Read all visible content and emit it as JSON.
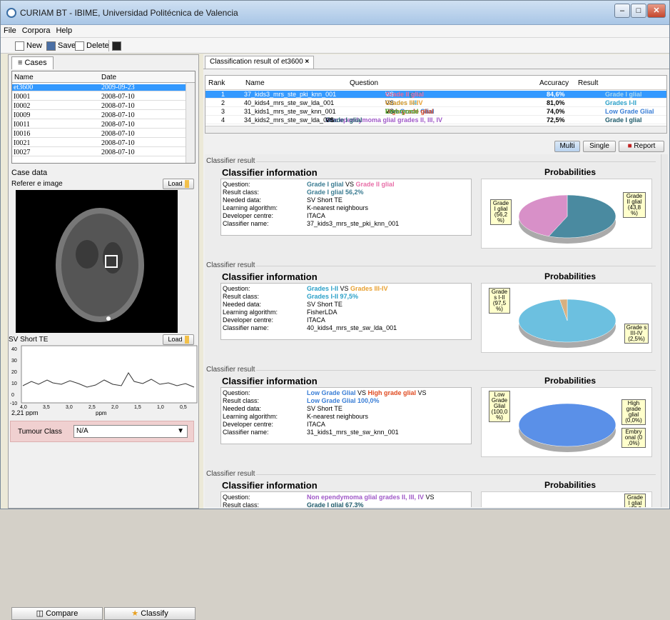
{
  "window": {
    "title": "CURIAM BT - IBIME, Universidad Politécnica de Valencia"
  },
  "menu": [
    "File",
    "Corpora",
    "Help"
  ],
  "toolbar": {
    "new": "New",
    "save": "Save",
    "delete": "Delete"
  },
  "cases": {
    "tab": "Cases",
    "col_name": "Name",
    "col_date": "Date",
    "rows": [
      {
        "name": "et3600",
        "date": "2009-09-23"
      },
      {
        "name": "I0001",
        "date": "2008-07-10"
      },
      {
        "name": "I0002",
        "date": "2008-07-10"
      },
      {
        "name": "I0009",
        "date": "2008-07-10"
      },
      {
        "name": "I0011",
        "date": "2008-07-10"
      },
      {
        "name": "I0016",
        "date": "2008-07-10"
      },
      {
        "name": "I0021",
        "date": "2008-07-10"
      },
      {
        "name": "I0027",
        "date": "2008-07-10"
      }
    ]
  },
  "case_data": {
    "title": "Case data",
    "ref_image": "Referer  e image",
    "load": "Load",
    "sv_label": "SV Short TE",
    "spectrum": {
      "y_ticks": [
        "40",
        "30",
        "20",
        "10",
        "0",
        "-10"
      ],
      "x_ticks": [
        "4,0",
        "3,5",
        "3,0",
        "2,5",
        "2,0",
        "1,5",
        "1,0",
        "0,5"
      ],
      "x_unit": "ppm",
      "cursor": "2,21 ppm"
    },
    "tumour_label": "Tumour Class",
    "tumour_value": "N/A"
  },
  "bottom": {
    "compare": "Compare",
    "classify": "Classify"
  },
  "right": {
    "tab": "Classification result of et3600",
    "tab_close": "×",
    "cols": {
      "rank": "Rank",
      "name": "Name",
      "question": "Question",
      "accuracy": "Accuracy",
      "result": "Result"
    },
    "rows": [
      {
        "rank": "1",
        "name": "37_kids3_mrs_ste_pki_knn_001",
        "accuracy": "84,6%",
        "result": "Grade I glial",
        "q": [
          [
            "Grade I glial",
            "hl-teal"
          ],
          [
            " VS ",
            ""
          ],
          [
            "Grade II glial",
            "hl-pink"
          ]
        ]
      },
      {
        "rank": "2",
        "name": "40_kids4_mrs_ste_sw_lda_001",
        "accuracy": "81,0%",
        "result": "Grades I-II",
        "q": [
          [
            "Grades I-II",
            "hl-cyan"
          ],
          [
            " VS ",
            ""
          ],
          [
            "Grades III-IV",
            "hl-orange"
          ]
        ]
      },
      {
        "rank": "3",
        "name": "31_kids1_mrs_ste_sw_knn_001",
        "accuracy": "74,0%",
        "result": "Low Grade Glial",
        "q": [
          [
            "Low Grade Glial",
            "hl-blue"
          ],
          [
            " VS ",
            ""
          ],
          [
            "High grade glial",
            "hl-red"
          ],
          [
            " VS ",
            ""
          ],
          [
            "Embryonal",
            "hl-green"
          ]
        ]
      },
      {
        "rank": "4",
        "name": "34_kids2_mrs_ste_sw_lda_001",
        "accuracy": "72,5%",
        "result": "Grade I glial",
        "q": [
          [
            "Non ependymoma glial grades II, III, IV",
            "hl-purple"
          ],
          [
            " VS ",
            ""
          ],
          [
            "Grade I glial",
            "hl-navy"
          ],
          [
            " VS",
            ""
          ]
        ]
      }
    ],
    "buttons": {
      "multi": "Multi",
      "single": "Single",
      "report": "Report"
    },
    "result_section": "Classifier result",
    "info_title": "Classifier information",
    "prob_title": "Probabilities",
    "keys": [
      "Question:",
      "Result class:",
      "Needed data:",
      "Learning algorithm:",
      "Developer centre:",
      "Classifier name:"
    ],
    "cards": [
      {
        "question": [
          [
            "Grade I glial",
            "hl-teal"
          ],
          [
            " VS ",
            ""
          ],
          [
            "Grade II glial",
            "hl-pink"
          ]
        ],
        "result_class": "Grade I glial 56,2%",
        "result_cls": "hl-teal",
        "needed": "SV Short TE",
        "algorithm": "K-nearest neighbours",
        "centre": "ITACA",
        "name": "37_kids3_mrs_ste_pki_knn_001",
        "pie": [
          {
            "label": "Grade I glial (56,2 %)",
            "value": 56.2,
            "color": "#4a8aa0"
          },
          {
            "label": "Grade II glial (43,8 %)",
            "value": 43.8,
            "color": "#d890c8"
          }
        ]
      },
      {
        "question": [
          [
            "Grades I-II",
            "hl-cyan"
          ],
          [
            " VS ",
            ""
          ],
          [
            "Grades III-IV",
            "hl-orange"
          ]
        ],
        "result_class": "Grades I-II 97,5%",
        "result_cls": "hl-cyan",
        "needed": "SV Short TE",
        "algorithm": "FisherLDA",
        "centre": "ITACA",
        "name": "40_kids4_mrs_ste_sw_lda_001",
        "pie": [
          {
            "label": "Grade s I-II (97,5 %)",
            "value": 97.5,
            "color": "#6cc0e0"
          },
          {
            "label": "Grade s III-IV (2,5%)",
            "value": 2.5,
            "color": "#d8b080"
          }
        ]
      },
      {
        "question": [
          [
            "Low Grade Glial",
            "hl-blue"
          ],
          [
            " VS ",
            ""
          ],
          [
            "High grade glial",
            "hl-red"
          ],
          [
            " VS",
            ""
          ]
        ],
        "result_class": "Low Grade Glial 100,0%",
        "result_cls": "hl-blue",
        "needed": "SV Short TE",
        "algorithm": "K-nearest neighbours",
        "centre": "ITACA",
        "name": "31_kids1_mrs_ste_sw_knn_001",
        "pie": [
          {
            "label": "Low Grade Glial (100,0 %)",
            "value": 100.0,
            "color": "#5a90e8"
          },
          {
            "label": "High grade glial (0,0%)",
            "value": 0.0,
            "color": "#e06040"
          },
          {
            "label": "Embry onal (0 ,0%)",
            "value": 0.0,
            "color": "#60c040"
          }
        ]
      },
      {
        "question": [
          [
            "Non ependymoma glial grades II, III, IV",
            "hl-purple"
          ],
          [
            " VS",
            ""
          ]
        ],
        "result_class": "Grade I glial 67,3%",
        "result_cls": "hl-navy",
        "pie": [
          {
            "label": "Grade I glial (67,3",
            "value": 67.3,
            "color": "#3e7f95"
          }
        ]
      }
    ]
  }
}
